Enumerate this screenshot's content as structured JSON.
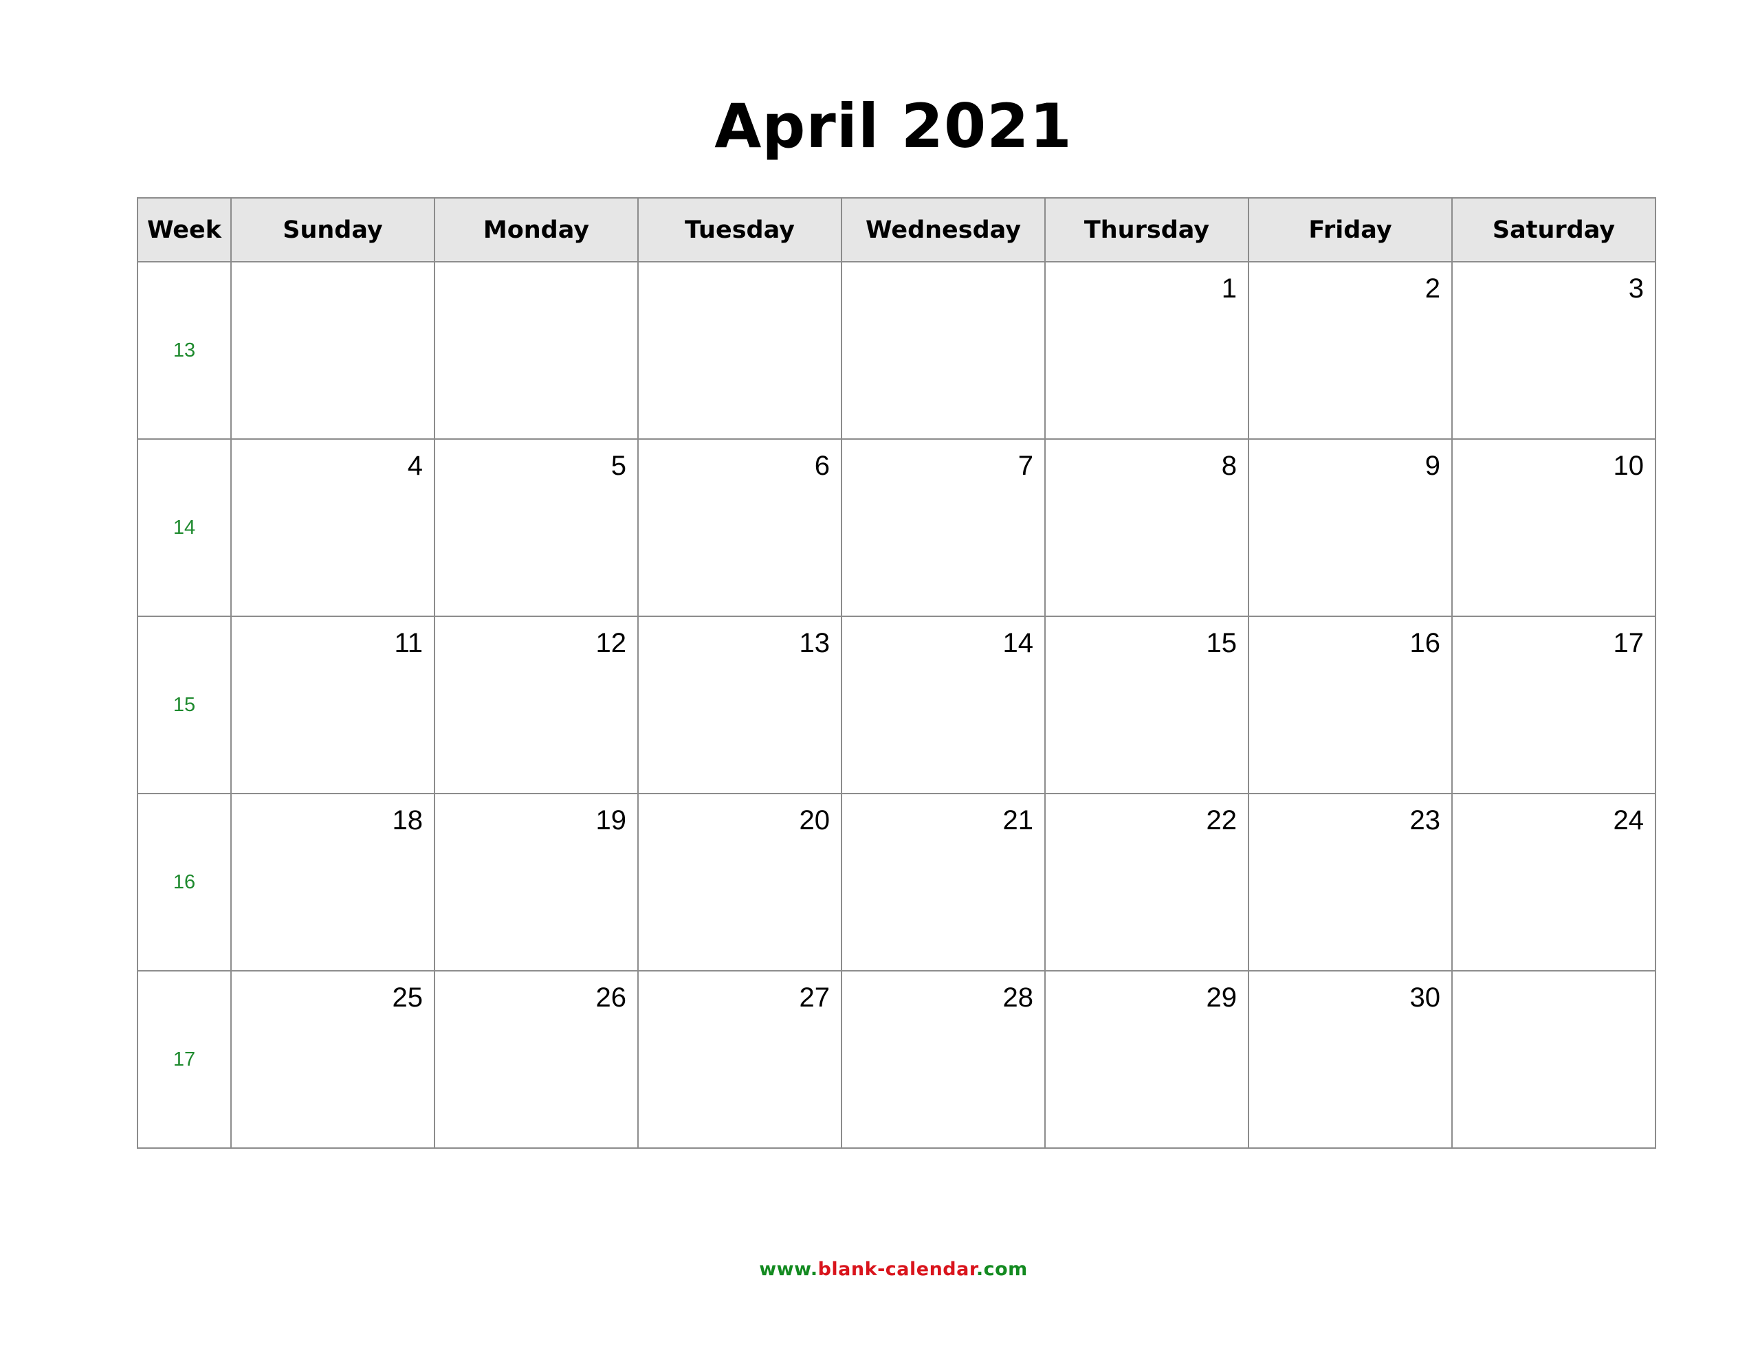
{
  "title": "April 2021",
  "header": {
    "week_label": "Week",
    "days": [
      "Sunday",
      "Monday",
      "Tuesday",
      "Wednesday",
      "Thursday",
      "Friday",
      "Saturday"
    ]
  },
  "weeks": [
    {
      "number": "13",
      "days": [
        "",
        "",
        "",
        "",
        "1",
        "2",
        "3"
      ]
    },
    {
      "number": "14",
      "days": [
        "4",
        "5",
        "6",
        "7",
        "8",
        "9",
        "10"
      ]
    },
    {
      "number": "15",
      "days": [
        "11",
        "12",
        "13",
        "14",
        "15",
        "16",
        "17"
      ]
    },
    {
      "number": "16",
      "days": [
        "18",
        "19",
        "20",
        "21",
        "22",
        "23",
        "24"
      ]
    },
    {
      "number": "17",
      "days": [
        "25",
        "26",
        "27",
        "28",
        "29",
        "30",
        ""
      ]
    }
  ],
  "footer": {
    "prefix": "www.",
    "name": "blank-calendar",
    "suffix": ".com"
  },
  "colors": {
    "week_number": "#1e8a2e",
    "footer_green": "#138a20",
    "footer_red": "#d9141c",
    "header_bg": "#e6e6e6",
    "grid": "#8c8c8c"
  }
}
